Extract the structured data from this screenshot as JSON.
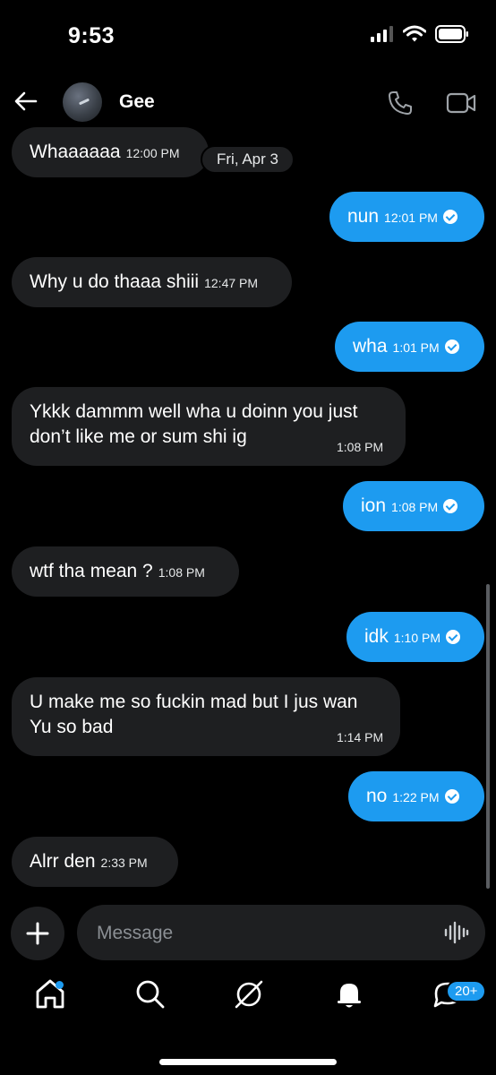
{
  "status_bar": {
    "time": "9:53"
  },
  "header": {
    "contact_name": "Gee"
  },
  "date_chip": "Fri, Apr 3",
  "messages": [
    {
      "dir": "in",
      "text": "Whaaaaaa",
      "time": "12:00 PM"
    },
    {
      "dir": "out",
      "text": "nun",
      "time": "12:01 PM"
    },
    {
      "dir": "in",
      "text": "Why u do thaaa shiii",
      "time": "12:47 PM"
    },
    {
      "dir": "out",
      "text": "wha",
      "time": "1:01 PM"
    },
    {
      "dir": "in",
      "text_line1": "Ykkk dammm well wha u doinn you just",
      "text_line2": "don’t like me or sum shi ig",
      "time": "1:08 PM"
    },
    {
      "dir": "out",
      "text": "ion",
      "time": "1:08 PM"
    },
    {
      "dir": "in",
      "text": "wtf tha mean ?",
      "time": "1:08 PM"
    },
    {
      "dir": "out",
      "text": "idk",
      "time": "1:10 PM"
    },
    {
      "dir": "in",
      "text_line1": "U make me so fuckin mad but I jus wan",
      "text_line2": "Yu so bad",
      "time": "1:14 PM"
    },
    {
      "dir": "out",
      "text": "no",
      "time": "1:22 PM"
    },
    {
      "dir": "in",
      "text": "Alrr den",
      "time": "2:33 PM"
    }
  ],
  "composer": {
    "placeholder": "Message"
  },
  "nav": {
    "messages_badge": "20+"
  },
  "colors": {
    "accent": "#1d9bf0",
    "incoming_bubble": "#1e1f21",
    "background": "#000000"
  },
  "icons": [
    "back-arrow-icon",
    "phone-icon",
    "video-icon",
    "plus-icon",
    "voice-wave-icon",
    "home-icon",
    "search-icon",
    "grok-icon",
    "bell-icon",
    "messages-icon"
  ]
}
